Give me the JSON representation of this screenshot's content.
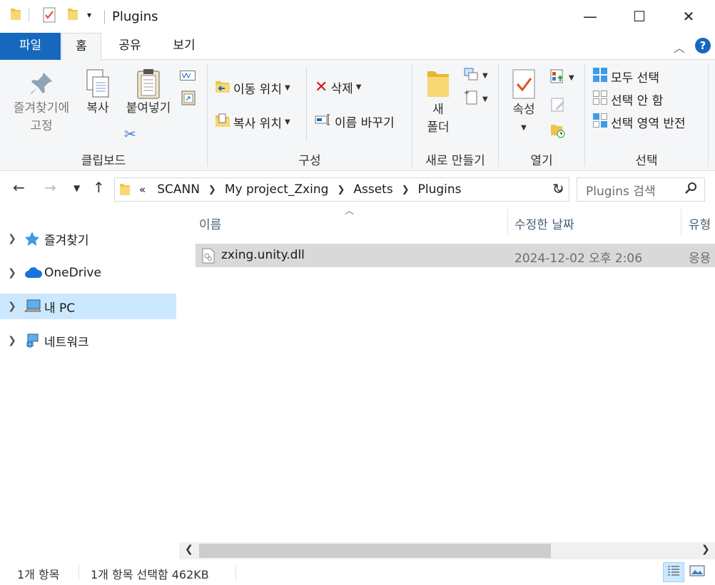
{
  "window": {
    "title": "Plugins",
    "minimize": "—",
    "maximize": "☐",
    "close": "✕"
  },
  "tabs": {
    "file": "파일",
    "home": "홈",
    "share": "공유",
    "view": "보기"
  },
  "ribbon": {
    "clipboard": {
      "group_label": "클립보드",
      "pin_line1": "즐겨찾기에",
      "pin_line2": "고정",
      "copy": "복사",
      "paste": "붙여넣기"
    },
    "organize": {
      "group_label": "구성",
      "move_to": "이동 위치",
      "copy_to": "복사 위치",
      "delete": "삭제",
      "rename": "이름 바꾸기"
    },
    "new": {
      "group_label": "새로 만들기",
      "new_folder_line1": "새",
      "new_folder_line2": "폴더"
    },
    "open": {
      "group_label": "열기",
      "properties": "속성"
    },
    "select": {
      "group_label": "선택",
      "select_all": "모두 선택",
      "select_none": "선택 안 함",
      "invert": "선택 영역 반전"
    }
  },
  "address": {
    "overflow": "«",
    "crumbs": [
      "SCANN",
      "My project_Zxing",
      "Assets",
      "Plugins"
    ],
    "search_placeholder": "Plugins 검색"
  },
  "navpane": {
    "items": [
      {
        "label": "즐겨찾기"
      },
      {
        "label": "OneDrive"
      },
      {
        "label": "내 PC"
      },
      {
        "label": "네트워크"
      }
    ]
  },
  "columns": {
    "name": "이름",
    "modified": "수정한 날짜",
    "type": "유형"
  },
  "files": [
    {
      "name": "zxing.unity.dll",
      "modified": "2024-12-02 오후 2:06",
      "type": "응용"
    }
  ],
  "status": {
    "count": "1개 항목",
    "selected": "1개 항목 선택함 462KB"
  },
  "colors": {
    "file_tab": "#1668bf",
    "selection": "#cce8ff",
    "row_selected": "#d9d9d9"
  }
}
